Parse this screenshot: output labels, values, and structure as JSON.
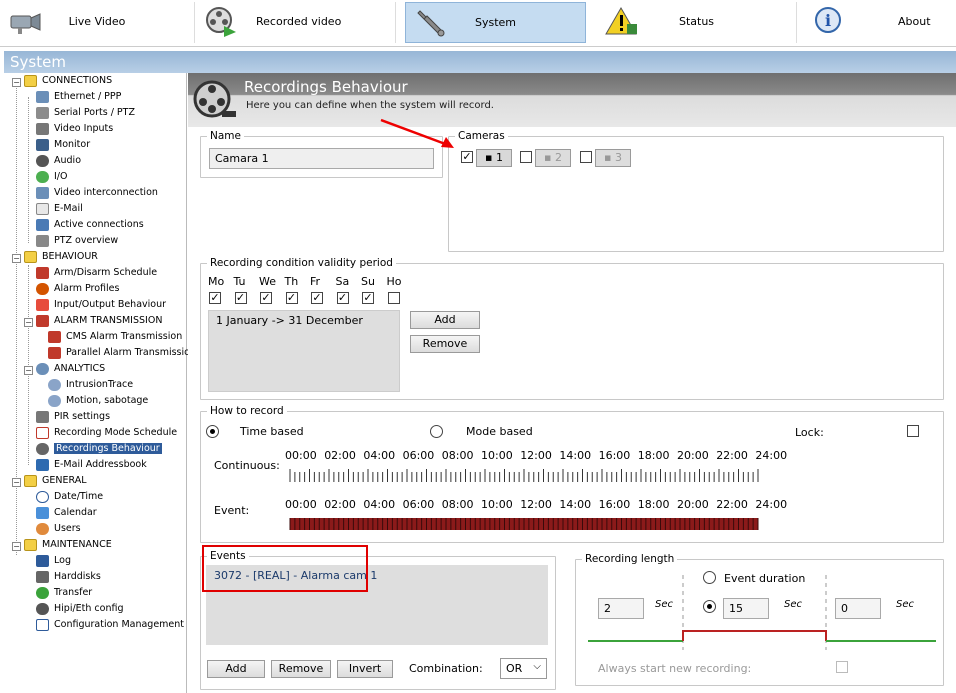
{
  "nav": {
    "tabs": [
      {
        "label": "Live Video",
        "icon": "camera-icon"
      },
      {
        "label": "Recorded video",
        "icon": "film-reel-icon"
      },
      {
        "label": "System",
        "icon": "wrench-icon"
      },
      {
        "label": "Status",
        "icon": "warning-icon"
      },
      {
        "label": "About",
        "icon": "info-icon"
      }
    ],
    "active": "System"
  },
  "window_title": "System",
  "tree": {
    "connections": {
      "label": "CONNECTIONS",
      "items": [
        "Ethernet / PPP",
        "Serial Ports / PTZ",
        "Video Inputs",
        "Monitor",
        "Audio",
        "I/O",
        "Video interconnection",
        "E-Mail",
        "Active connections",
        "PTZ overview"
      ]
    },
    "behaviour": {
      "label": "BEHAVIOUR",
      "items": [
        "Arm/Disarm Schedule",
        "Alarm Profiles",
        "Input/Output Behaviour"
      ]
    },
    "alarm_transmission": {
      "label": "ALARM TRANSMISSION",
      "items": [
        "CMS Alarm Transmission",
        "Parallel Alarm Transmission"
      ]
    },
    "analytics": {
      "label": "ANALYTICS",
      "items": [
        "IntrusionTrace",
        "Motion, sabotage"
      ]
    },
    "behaviour_more": [
      "PIR settings",
      "Recording Mode Schedule",
      "Recordings Behaviour",
      "E-Mail Addressbook"
    ],
    "general": {
      "label": "GENERAL",
      "items": [
        "Date/Time",
        "Calendar",
        "Users"
      ]
    },
    "maintenance": {
      "label": "MAINTENANCE",
      "items": [
        "Log",
        "Harddisks",
        "Transfer",
        "Hipi/Eth config",
        "Configuration Management"
      ]
    },
    "selected": "Recordings Behaviour"
  },
  "page": {
    "title": "Recordings Behaviour",
    "subtitle": "Here you can define when the system will record."
  },
  "name_section": {
    "legend": "Name",
    "value": "Camara 1"
  },
  "cameras_section": {
    "legend": "Cameras",
    "cameras": [
      {
        "label": "1",
        "checked": true
      },
      {
        "label": "2",
        "checked": false
      },
      {
        "label": "3",
        "checked": false
      }
    ]
  },
  "validity": {
    "legend": "Recording condition validity period",
    "days": [
      "Mo",
      "Tu",
      "We",
      "Th",
      "Fr",
      "Sa",
      "Su",
      "Ho"
    ],
    "day_checked": [
      true,
      true,
      true,
      true,
      true,
      true,
      true,
      false
    ],
    "periods": [
      "1 January -> 31 December"
    ],
    "add_label": "Add",
    "remove_label": "Remove"
  },
  "how_to_record": {
    "legend": "How to record",
    "time_based": "Time based",
    "mode_based": "Mode based",
    "lock": "Lock:",
    "continuous": "Continuous:",
    "event": "Event:",
    "hours": [
      "00:00",
      "02:00",
      "04:00",
      "06:00",
      "08:00",
      "10:00",
      "12:00",
      "14:00",
      "16:00",
      "18:00",
      "20:00",
      "22:00",
      "24:00"
    ]
  },
  "events": {
    "legend": "Events",
    "items": [
      "3072 - [REAL] -  Alarma cam 1"
    ],
    "add_label": "Add",
    "remove_label": "Remove",
    "invert_label": "Invert",
    "combination_label": "Combination:",
    "combination_value": "OR"
  },
  "recording_length": {
    "legend": "Recording length",
    "pre_value": "2",
    "event_value": "15",
    "post_value": "0",
    "unit": "Sec",
    "event_duration": "Event duration",
    "always_new": "Always start new recording:"
  },
  "colors": {
    "accent": "#2e5b9a",
    "highlight_box": "#e00000",
    "event_track": "#8b1a1a"
  }
}
